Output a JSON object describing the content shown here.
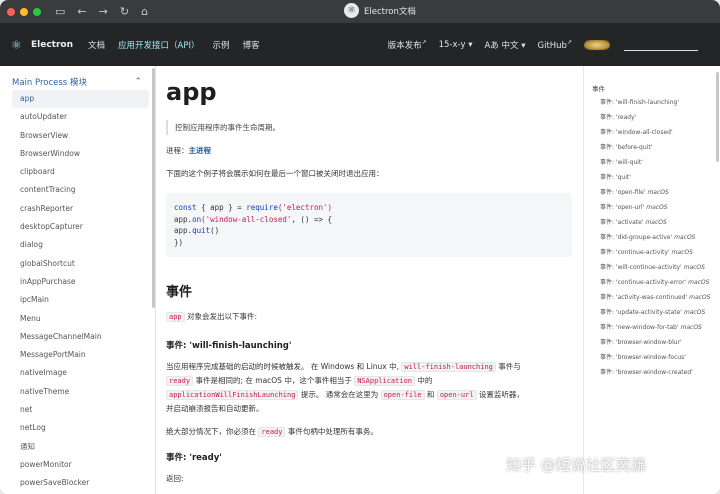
{
  "window": {
    "tab_title": "Electron文档"
  },
  "navbar": {
    "brand": "Electron",
    "links": [
      "文档",
      "应用开发接口（API）",
      "示例",
      "博客"
    ],
    "right": {
      "releases": "版本发布",
      "version": "15-x-y",
      "language": "中文",
      "github": "GitHub"
    }
  },
  "sidebar": {
    "section_title": "Main Process 模块",
    "items": [
      "app",
      "autoUpdater",
      "BrowserView",
      "BrowserWindow",
      "clipboard",
      "contentTracing",
      "crashReporter",
      "desktopCapturer",
      "dialog",
      "globalShortcut",
      "inAppPurchase",
      "ipcMain",
      "Menu",
      "MessageChannelMain",
      "MessagePortMain",
      "nativeImage",
      "nativeTheme",
      "net",
      "netLog",
      "通知",
      "powerMonitor",
      "powerSaveBlocker"
    ]
  },
  "content": {
    "title": "app",
    "subtitle": "控制应用程序的事件生命周期。",
    "process_label": "进程：",
    "process_link": "主进程",
    "example_intro": "下面的这个例子将会展示如何在最后一个窗口被关闭时退出应用：",
    "code": {
      "line1_kw": "const",
      "line1_mid": " { app } = ",
      "line1_fn": "require",
      "line1_str": "('electron')",
      "line2_pre": "app.",
      "line2_kw": "on",
      "line2_str": "('window-all-closed'",
      "line2_post": ", () => {",
      "line3_pre": "  app.",
      "line3_kw": "quit",
      "line3_post": "()",
      "line4": "})"
    },
    "events_heading": "事件",
    "events_intro_code": "app",
    "events_intro_text": " 对象会发出以下事件:",
    "event1_heading": "事件: 'will-finish-launching'",
    "event1_p1_a": "当应用程序完成基础的启动的时候被触发。 在 Windows 和 Linux 中, ",
    "event1_p1_code1": "will-finish-launching",
    "event1_p1_b": " 事件与",
    "event1_p2_code1": "ready",
    "event1_p2_a": " 事件是相同的; 在 macOS 中，这个事件相当于 ",
    "event1_p2_code2": "NSApplication",
    "event1_p2_b": " 中的",
    "event1_p3_code1": "applicationWillFinishLaunching",
    "event1_p3_a": " 提示。 通常会在这里为 ",
    "event1_p3_code2": "open-file",
    "event1_p3_b": " 和 ",
    "event1_p3_code3": "open-url",
    "event1_p3_c": " 设置监听器，",
    "event1_p4": "并启动崩溃报告和自动更新。",
    "event1_p5_a": "绝大部分情况下，你必须在 ",
    "event1_p5_code": "ready",
    "event1_p5_b": " 事件句柄中处理所有事务。",
    "event2_heading": "事件: 'ready'",
    "event2_returns": "返回:"
  },
  "toc": {
    "heading": "事件",
    "items": [
      {
        "text": "事件: 'will-finish-launching'",
        "os": ""
      },
      {
        "text": "事件: 'ready'",
        "os": ""
      },
      {
        "text": "事件: 'window-all-closed'",
        "os": ""
      },
      {
        "text": "事件: 'before-quit'",
        "os": ""
      },
      {
        "text": "事件: 'will-quit'",
        "os": ""
      },
      {
        "text": "事件: 'quit'",
        "os": ""
      },
      {
        "text": "事件: 'open-file'",
        "os": "macOS"
      },
      {
        "text": "事件: 'open-url'",
        "os": "macOS"
      },
      {
        "text": "事件: 'activate'",
        "os": "macOS"
      },
      {
        "text": "事件: 'did-groupe-active'",
        "os": "macOS"
      },
      {
        "text": "事件: 'continue-activity'",
        "os": "macOS"
      },
      {
        "text": "事件: 'will-continue-activity'",
        "os": "macOS"
      },
      {
        "text": "事件: 'continue-activity-error'",
        "os": "macOS"
      },
      {
        "text": "事件: 'activity-was-continued'",
        "os": "macOS"
      },
      {
        "text": "事件: 'update-activity-state'",
        "os": "macOS"
      },
      {
        "text": "事件: 'new-window-for-tab'",
        "os": "macOS"
      },
      {
        "text": "事件: 'browser-window-blur'",
        "os": ""
      },
      {
        "text": "事件: 'browser-window-focus'",
        "os": ""
      },
      {
        "text": "事件: 'browser-window-created'",
        "os": ""
      }
    ]
  },
  "watermark": "知乎 @短说社区奕濂"
}
